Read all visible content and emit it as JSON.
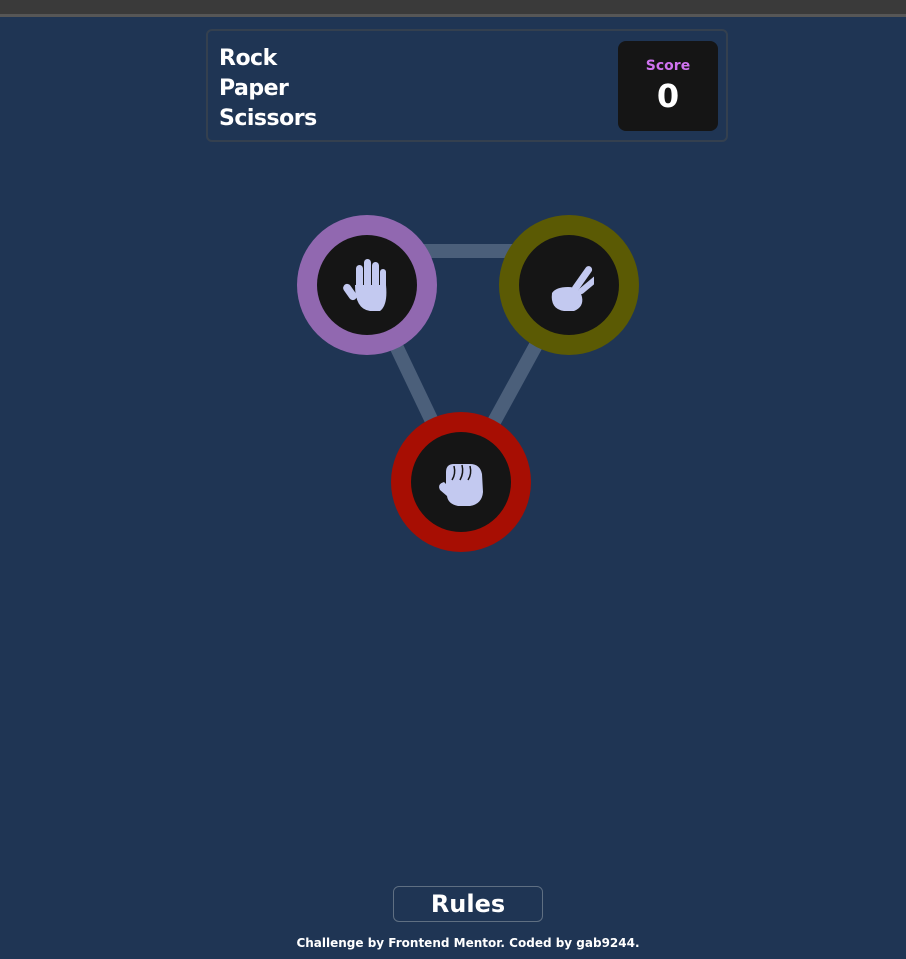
{
  "header": {
    "title_lines": [
      "Rock",
      "Paper",
      "Scissors"
    ],
    "score_label": "Score",
    "score_value": "0"
  },
  "choices": [
    {
      "name": "paper",
      "icon": "paper-hand-icon",
      "ring_color": "#9168b0"
    },
    {
      "name": "scissors",
      "icon": "scissors-hand-icon",
      "ring_color": "#5b5a04"
    },
    {
      "name": "rock",
      "icon": "rock-fist-icon",
      "ring_color": "#a70e03"
    }
  ],
  "colors": {
    "background": "#1f3554",
    "icon_fill": "#c3c9f0",
    "inner_circle": "#151515",
    "connector": "#4b5f7a",
    "score_label": "#cf73f0"
  },
  "rules_button": {
    "label": "Rules"
  },
  "footer": {
    "text": "Challenge by Frontend Mentor. Coded by gab9244."
  }
}
